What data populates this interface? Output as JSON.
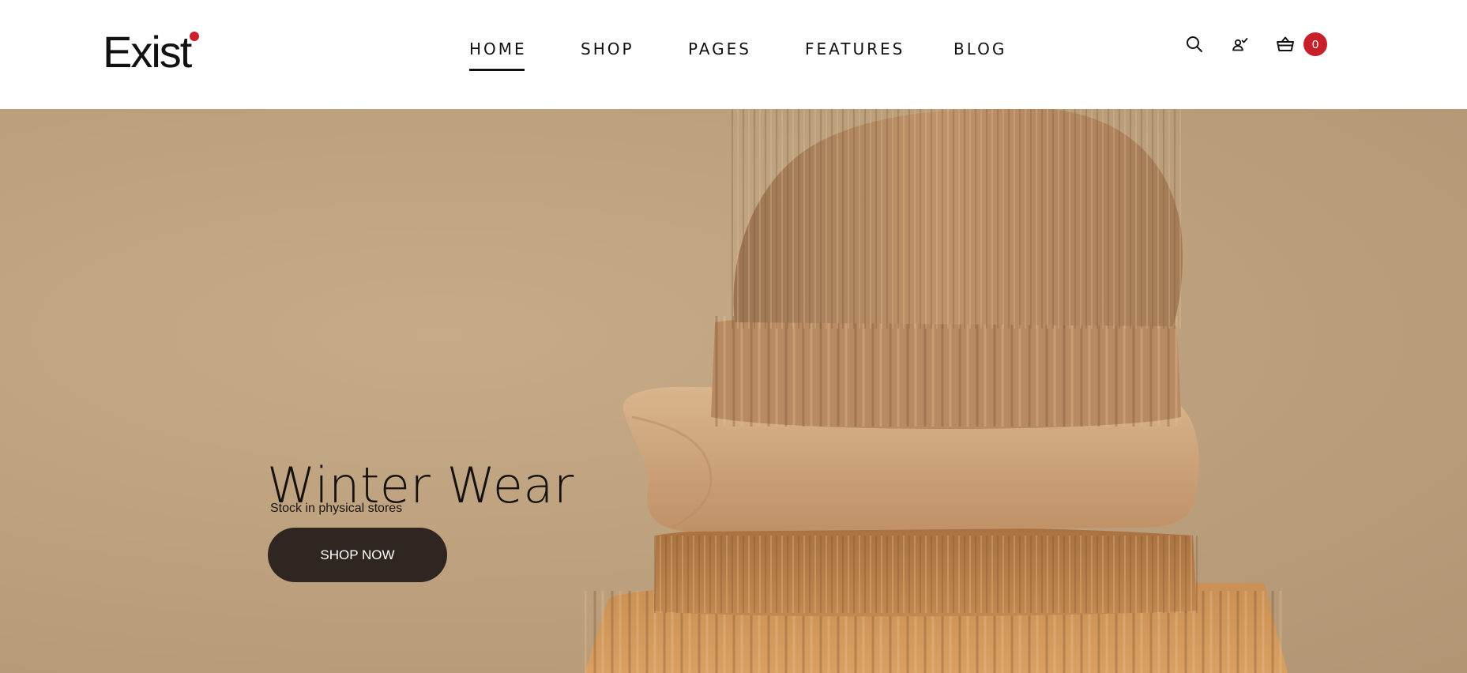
{
  "brand": {
    "name": "Exist",
    "accent": "#c8202a"
  },
  "nav": {
    "items": [
      {
        "label": "HOME",
        "active": true
      },
      {
        "label": "SHOP"
      },
      {
        "label": "PAGES"
      },
      {
        "label": "FEATURES"
      },
      {
        "label": "BLOG"
      }
    ]
  },
  "header_icons": {
    "search": "search-icon",
    "account": "user-check-icon",
    "cart": "basket-icon",
    "cart_count": "0"
  },
  "hero": {
    "title": "Winter Wear",
    "subtitle": "Stock in physical stores",
    "cta_label": "SHOP NOW",
    "image": "knit-beanie-and-folded-sweaters-photo"
  },
  "colors": {
    "hero_background": "#bea27f",
    "button_bg": "#2f2621",
    "text": "#111111"
  }
}
